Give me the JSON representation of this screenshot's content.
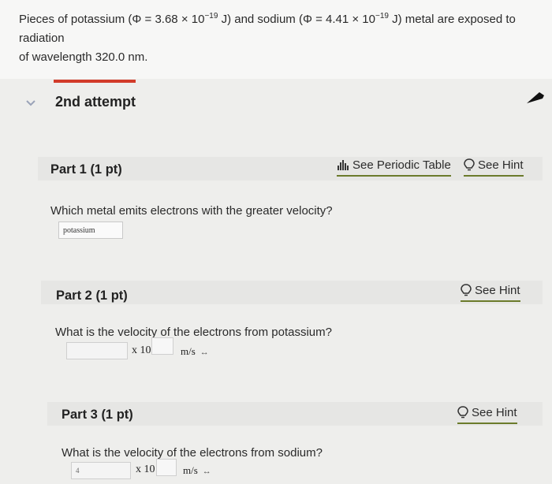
{
  "question": {
    "line1_prefix": "Pieces of potassium (Φ = 3.68 × 10",
    "exp1": "−19",
    "line1_mid": " J) and sodium (Φ = 4.41 × 10",
    "exp2": "−19",
    "line1_suffix": " J) metal are exposed to radiation",
    "line2": "of wavelength 320.0 nm."
  },
  "attempt": {
    "title": "2nd attempt"
  },
  "part1": {
    "title": "Part 1 (1 pt)",
    "periodic_table_label": "See Periodic Table",
    "hint_label": "See Hint",
    "question": "Which metal emits electrons with the greater velocity?",
    "answer_value": "potassium"
  },
  "part2": {
    "title": "Part 2 (1 pt)",
    "hint_label": "See Hint",
    "question": "What is the velocity of the electrons from potassium?",
    "times_label": "x 10",
    "unit": "m/s",
    "value": "",
    "exponent": ""
  },
  "part3": {
    "title": "Part 3 (1 pt)",
    "hint_label": "See Hint",
    "question": "What is the velocity of the electrons from sodium?",
    "times_label": "x 10",
    "unit": "m/s",
    "value": "4",
    "exponent": ""
  },
  "colors": {
    "accent_underline": "#6b7b2b",
    "attempt_bar": "#d23b2a",
    "header_band": "#e6e6e4"
  },
  "icons": {
    "collapse": "chevron-down-icon",
    "periodic_table": "periodic-table-icon",
    "hint": "lightbulb-icon",
    "corner": "arrow-icon"
  }
}
